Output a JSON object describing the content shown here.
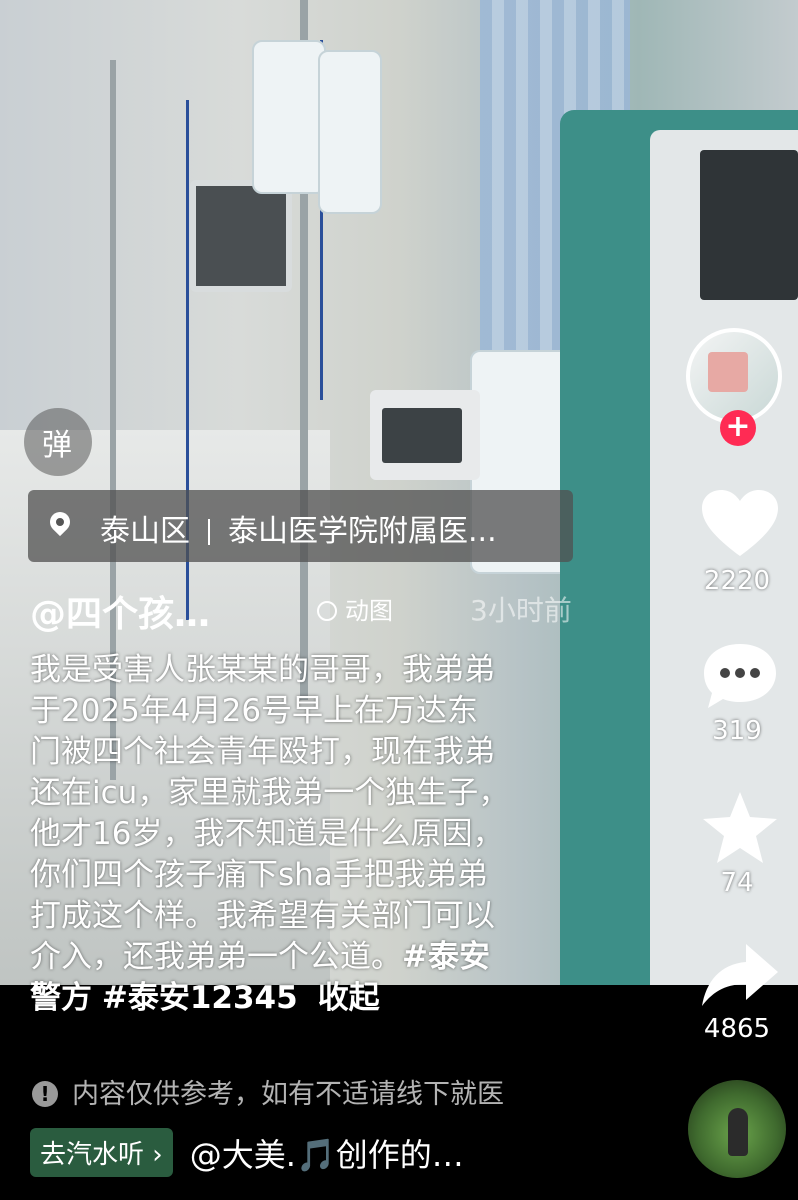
{
  "danmu": {
    "label": "弹"
  },
  "location": {
    "district": "泰山区",
    "place": "泰山医学院附属医..."
  },
  "post": {
    "author": "@四个孩…",
    "motion_label": "动图",
    "time": "3小时前",
    "caption_lines": [
      "我是受害人张某某的哥哥，我弟弟",
      "于2025年4月26号早上在万达东",
      "门被四个社会青年殴打，现在我弟",
      "还在icu，家里就我弟一个独生子，",
      "他才16岁，我不知道是什么原因，",
      "你们四个孩子痛下sha手把我弟弟",
      "打成这个样。我希望有关部门可以"
    ],
    "caption_line8": "介入，还我弟弟一个公道。",
    "hashtag1_part1": "#泰安",
    "hashtag1_part2": "警方",
    "hashtag2": "#泰安12345",
    "fold_label": "收起"
  },
  "disclaimer": "内容仅供参考，如有不适请线下就医",
  "music": {
    "app_label": "去汽水听",
    "text": "@大美.🎵创作的…"
  },
  "actions": {
    "likes": "2220",
    "comments": "319",
    "favorites": "74",
    "shares": "4865"
  },
  "colors": {
    "follow": "#ff2b54",
    "qishui": "#2a5c3f"
  }
}
